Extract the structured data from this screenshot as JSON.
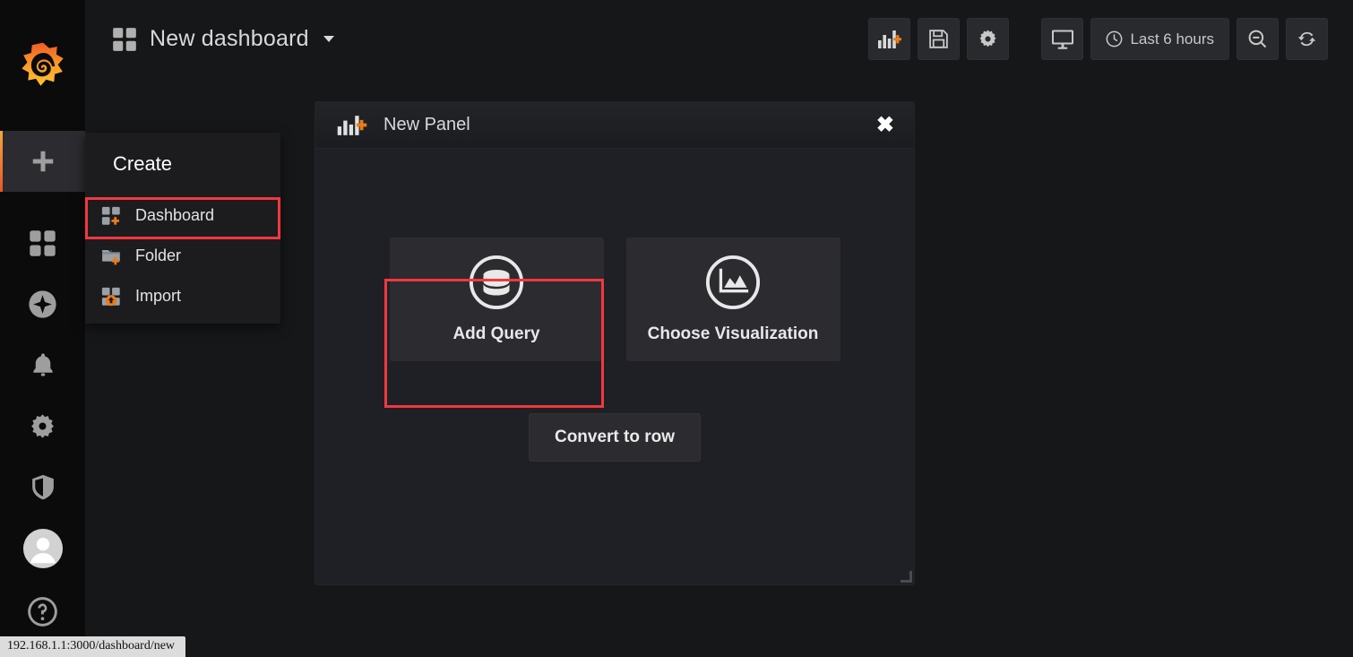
{
  "app": {
    "brand_icon": "grafana-logo-icon",
    "background": "#161719",
    "accent": "#f0383e",
    "orange": "#eb7b18"
  },
  "sidebar": {
    "items": [
      {
        "icon": "plus-icon",
        "name": "create",
        "active": true
      },
      {
        "icon": "grid-icon",
        "name": "dashboards",
        "active": false
      },
      {
        "icon": "compass-icon",
        "name": "explore",
        "active": false
      },
      {
        "icon": "bell-icon",
        "name": "alerting",
        "active": false
      },
      {
        "icon": "gear-icon",
        "name": "configuration",
        "active": false
      },
      {
        "icon": "shield-icon",
        "name": "server-admin",
        "active": false
      }
    ],
    "bottom_items": [
      {
        "icon": "user-avatar-icon",
        "name": "user-profile"
      },
      {
        "icon": "question-circle-icon",
        "name": "help"
      }
    ]
  },
  "topbar": {
    "dashboard_icon": "dashboard-grid-icon",
    "title": "New dashboard",
    "caret": "chevron-down-icon",
    "buttons": [
      {
        "name": "add-panel",
        "icon": "add-panel-icon"
      },
      {
        "name": "save-dashboard",
        "icon": "save-icon"
      },
      {
        "name": "dashboard-settings",
        "icon": "gear-icon"
      },
      {
        "name": "cycle-view-mode",
        "icon": "monitor-icon"
      }
    ],
    "time_picker": {
      "icon": "clock-icon",
      "label": "Last 6 hours"
    },
    "zoom_out": {
      "name": "zoom-out",
      "icon": "zoom-out-icon"
    },
    "refresh": {
      "name": "refresh",
      "icon": "refresh-icon"
    }
  },
  "create_menu": {
    "heading": "Create",
    "items": [
      {
        "label": "Dashboard",
        "icon": "dashboard-add-icon",
        "highlighted": true
      },
      {
        "label": "Folder",
        "icon": "folder-add-icon",
        "highlighted": false
      },
      {
        "label": "Import",
        "icon": "import-icon",
        "highlighted": false
      }
    ]
  },
  "panel": {
    "icon": "add-panel-icon",
    "title": "New Panel",
    "close_label": "✖",
    "cards": [
      {
        "label": "Add Query",
        "icon": "database-icon",
        "highlighted": true
      },
      {
        "label": "Choose Visualization",
        "icon": "graph-icon",
        "highlighted": false
      }
    ],
    "convert_button": "Convert to row"
  },
  "statusbar": {
    "url": "192.168.1.1:3000/dashboard/new"
  }
}
